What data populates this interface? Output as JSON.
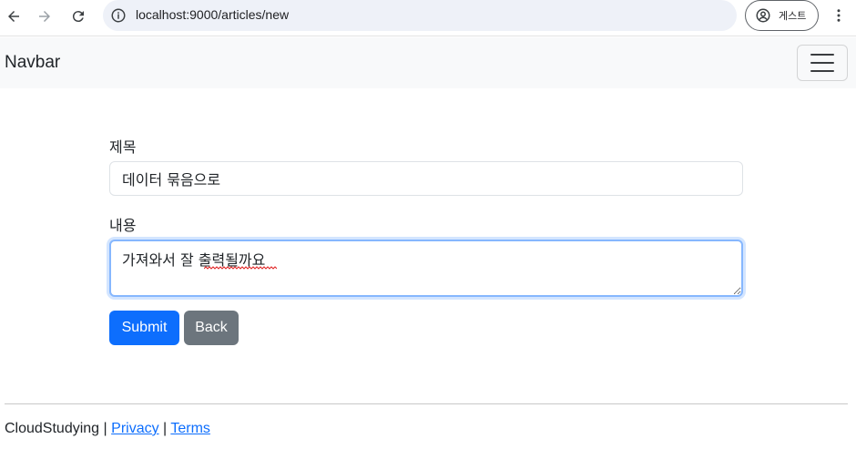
{
  "browser": {
    "url": "localhost:9000/articles/new",
    "profile_label": "게스트",
    "icons": [
      "back-arrow-icon",
      "forward-arrow-icon",
      "reload-icon",
      "site-info-icon",
      "profile-icon",
      "kebab-menu-icon"
    ]
  },
  "navbar": {
    "brand": "Navbar",
    "toggler_icon": "hamburger-icon"
  },
  "form": {
    "title_label": "제목",
    "title_value": "데이터 묶음으로",
    "content_label": "내용",
    "content_value": "가져와서 잘 출력될까요",
    "submit_label": "Submit",
    "back_label": "Back"
  },
  "footer": {
    "brand": "CloudStudying",
    "separator": "|",
    "privacy_label": "Privacy",
    "terms_label": "Terms"
  },
  "colors": {
    "primary": "#0d6efd",
    "secondary": "#6c757d",
    "navbar_bg": "#f8f9fa",
    "focus_border": "#86b7fe"
  }
}
